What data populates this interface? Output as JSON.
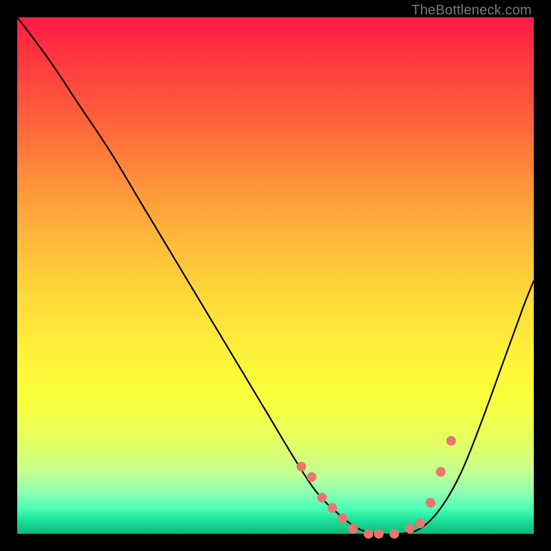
{
  "attribution": "TheBottleneck.com",
  "chart_data": {
    "type": "line",
    "title": "",
    "xlabel": "",
    "ylabel": "",
    "xlim": [
      0,
      100
    ],
    "ylim": [
      0,
      100
    ],
    "series": [
      {
        "name": "bottleneck-curve",
        "x": [
          0,
          6,
          12,
          18,
          24,
          30,
          36,
          42,
          48,
          54,
          58,
          62,
          66,
          70,
          74,
          78,
          82,
          86,
          90,
          94,
          98,
          100
        ],
        "y": [
          100,
          92,
          83,
          74,
          64,
          54,
          44,
          34,
          24,
          14,
          8,
          4,
          1,
          0,
          0,
          1,
          5,
          12,
          22,
          33,
          44,
          49
        ]
      },
      {
        "name": "sample-points",
        "x": [
          55,
          57,
          59,
          61,
          63,
          65,
          68,
          70,
          73,
          76,
          78,
          80,
          82,
          84
        ],
        "y": [
          13,
          11,
          7,
          5,
          3,
          1,
          0,
          0,
          0,
          1,
          2,
          6,
          12,
          18
        ]
      }
    ]
  },
  "colors": {
    "dot": "#e9766e",
    "curve": "#000000"
  }
}
